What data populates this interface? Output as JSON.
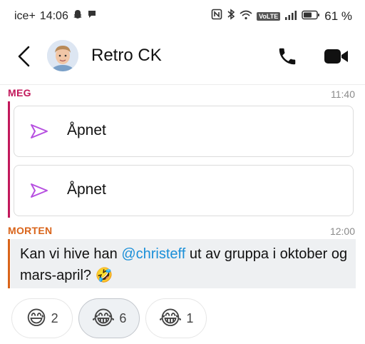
{
  "status": {
    "carrier": "ice+",
    "time": "14:06",
    "battery": "61 %",
    "volte": "VoLTE"
  },
  "header": {
    "title": "Retro CK"
  },
  "messages": [
    {
      "sender": "MEG",
      "time": "11:40",
      "color": "#c2185b",
      "cards": [
        {
          "label": "Åpnet"
        },
        {
          "label": "Åpnet"
        }
      ]
    },
    {
      "sender": "MORTEN",
      "time": "12:00",
      "color": "#d9641a",
      "text_before": "Kan vi hive han ",
      "mention": "@christeff",
      "text_after": " ut av gruppa i oktober og mars-april? 🤣"
    }
  ],
  "reactions": [
    {
      "emoji": "😅",
      "count": "2",
      "selected": false
    },
    {
      "emoji": "😂",
      "count": "6",
      "selected": true
    },
    {
      "emoji": "😂",
      "count": "1",
      "selected": false
    }
  ],
  "colors": {
    "opened_arrow": "#b64fe0",
    "mention": "#1a8fd8"
  }
}
